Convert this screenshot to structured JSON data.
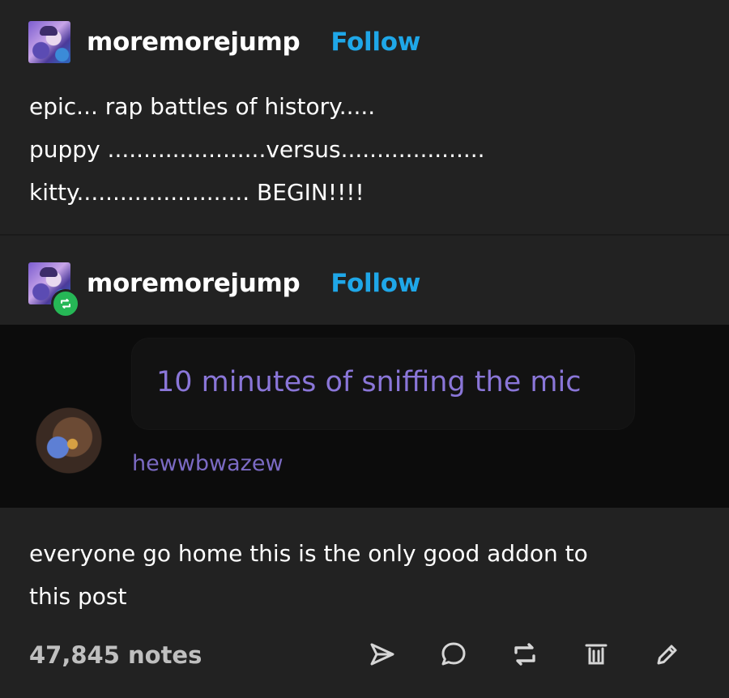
{
  "post1": {
    "username": "moremorejump",
    "follow_label": "Follow",
    "lines": [
      "epic... rap battles of history.....",
      "puppy ......................versus....................",
      "kitty........................ BEGIN!!!!"
    ]
  },
  "post2": {
    "username": "moremorejump",
    "follow_label": "Follow",
    "embedded_message": {
      "text": "10 minutes of sniffing the mic",
      "author": "hewwbwazew"
    },
    "caption": [
      "everyone go home this is the only good addon to",
      "this post"
    ],
    "notes": "47,845 notes",
    "actions": [
      "send-icon",
      "comment-icon",
      "reblog-icon",
      "delete-icon",
      "edit-icon"
    ]
  },
  "colors": {
    "background": "#222222",
    "follow": "#1fa7e8",
    "reblog_badge": "#26b756",
    "message_text": "#8a76d8"
  }
}
